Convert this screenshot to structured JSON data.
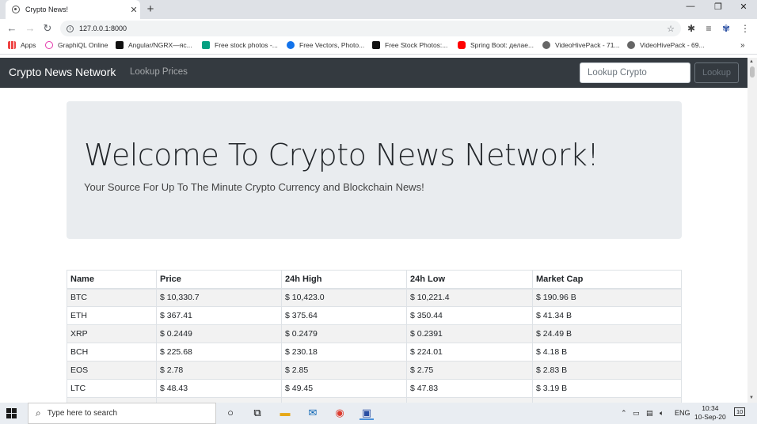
{
  "browser": {
    "tab_title": "Crypto News!",
    "url": "127.0.0.1:8000",
    "bookmarks": [
      "Apps",
      "GraphiQL Online",
      "Angular/NGRX—яс...",
      "Free stock photos -...",
      "Free Vectors, Photo...",
      "Free Stock Photos:...",
      "Spring Boot: делае...",
      "VideoHivePack - 71...",
      "VideoHivePack - 69..."
    ]
  },
  "navbar": {
    "brand": "Crypto News Network",
    "link": "Lookup Prices",
    "search_placeholder": "Lookup Crypto",
    "button_label": "Lookup"
  },
  "jumbotron": {
    "title": "Welcome To Crypto News Network!",
    "subtitle": "Your Source For Up To The Minute Crypto Currency and Blockchain News!"
  },
  "table": {
    "headers": [
      "Name",
      "Price",
      "24h High",
      "24h Low",
      "Market Cap"
    ],
    "rows": [
      [
        "BTC",
        "$ 10,330.7",
        "$ 10,423.0",
        "$ 10,221.4",
        "$ 190.96 B"
      ],
      [
        "ETH",
        "$ 367.41",
        "$ 375.64",
        "$ 350.44",
        "$ 41.34 B"
      ],
      [
        "XRP",
        "$ 0.2449",
        "$ 0.2479",
        "$ 0.2391",
        "$ 24.49 B"
      ],
      [
        "BCH",
        "$ 225.68",
        "$ 230.18",
        "$ 224.01",
        "$ 4.18 B"
      ],
      [
        "EOS",
        "$ 2.78",
        "$ 2.85",
        "$ 2.75",
        "$ 2.83 B"
      ],
      [
        "LTC",
        "$ 48.43",
        "$ 49.45",
        "$ 47.83",
        "$ 3.19 B"
      ],
      [
        "",
        "",
        "",
        "",
        ""
      ]
    ]
  },
  "taskbar": {
    "search_placeholder": "Type here to search",
    "language": "ENG",
    "time": "10:34",
    "date": "10-Sep-20",
    "notification_count": "10"
  }
}
